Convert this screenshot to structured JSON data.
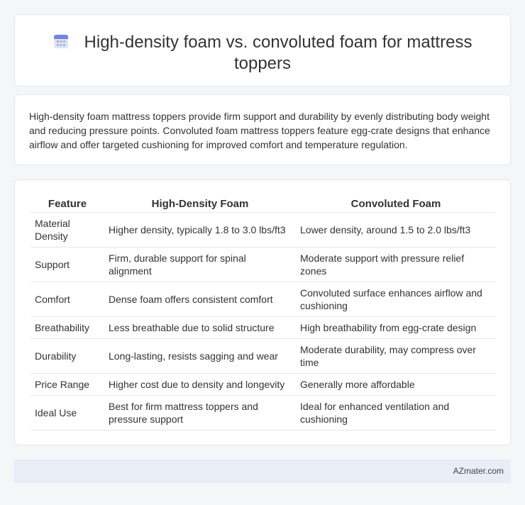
{
  "title": "High-density foam vs. convoluted foam for mattress toppers",
  "title_icon": "calendar-grid-icon",
  "description": "High-density foam mattress toppers provide firm support and durability by evenly distributing body weight and reducing pressure points. Convoluted foam mattress toppers feature egg-crate designs that enhance airflow and offer targeted cushioning for improved comfort and temperature regulation.",
  "table": {
    "headers": [
      "Feature",
      "High-Density Foam",
      "Convoluted Foam"
    ],
    "rows": [
      [
        "Material Density",
        "Higher density, typically 1.8 to 3.0 lbs/ft3",
        "Lower density, around 1.5 to 2.0 lbs/ft3"
      ],
      [
        "Support",
        "Firm, durable support for spinal alignment",
        "Moderate support with pressure relief zones"
      ],
      [
        "Comfort",
        "Dense foam offers consistent comfort",
        "Convoluted surface enhances airflow and cushioning"
      ],
      [
        "Breathability",
        "Less breathable due to solid structure",
        "High breathability from egg-crate design"
      ],
      [
        "Durability",
        "Long-lasting, resists sagging and wear",
        "Moderate durability, may compress over time"
      ],
      [
        "Price Range",
        "Higher cost due to density and longevity",
        "Generally more affordable"
      ],
      [
        "Ideal Use",
        "Best for firm mattress toppers and pressure support",
        "Ideal for enhanced ventilation and cushioning"
      ]
    ]
  },
  "footer": "AZmater.com",
  "colors": {
    "background": "#f5f6f8",
    "card": "#ffffff",
    "border": "#e3e6ea",
    "footer_bg": "#e8edf6"
  }
}
